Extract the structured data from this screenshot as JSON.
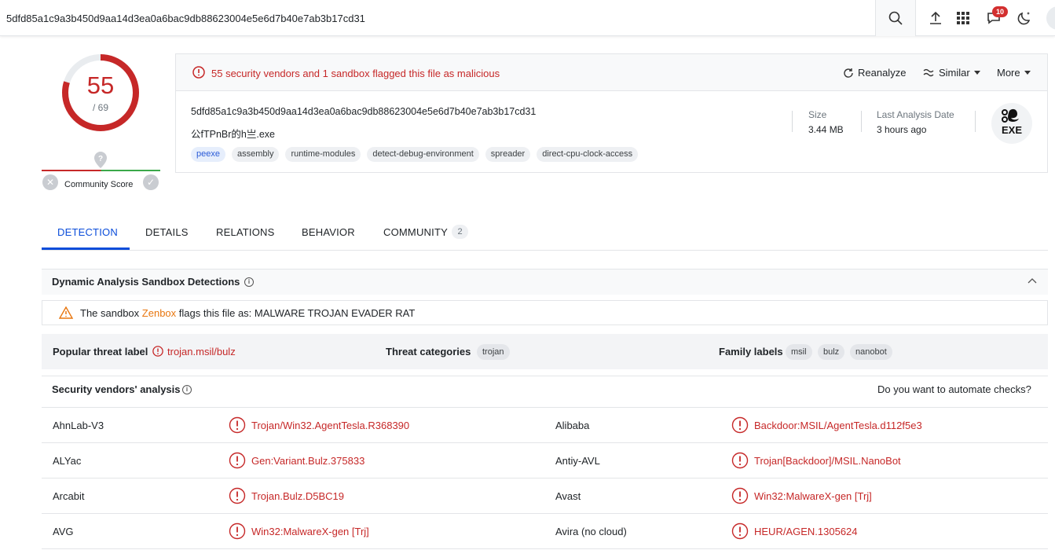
{
  "search": {
    "value": "5dfd85a1c9a3b450d9aa14d3ea0a6bac9db88623004e5e6d7b40e7ab3b17cd31"
  },
  "header": {
    "notifications_count": "10"
  },
  "score": {
    "detections": "55",
    "total": "/ 69",
    "fraction": 0.797
  },
  "community": {
    "label": "Community Score",
    "question": "?"
  },
  "summary": {
    "alert": "55 security vendors and 1 sandbox flagged this file as malicious",
    "actions": {
      "reanalyze": "Reanalyze",
      "similar": "Similar",
      "more": "More"
    },
    "hash": "5dfd85a1c9a3b450d9aa14d3ea0a6bac9db88623004e5e6d7b40e7ab3b17cd31",
    "filename": "公fTPnBr的h亗.exe",
    "tags": [
      "peexe",
      "assembly",
      "runtime-modules",
      "detect-debug-environment",
      "spreader",
      "direct-cpu-clock-access"
    ],
    "size_label": "Size",
    "size_value": "3.44 MB",
    "last_analysis_label": "Last Analysis Date",
    "last_analysis_value": "3 hours ago",
    "file_type": "EXE"
  },
  "tabs": [
    {
      "label": "DETECTION",
      "active": true
    },
    {
      "label": "DETAILS"
    },
    {
      "label": "RELATIONS"
    },
    {
      "label": "BEHAVIOR"
    },
    {
      "label": "COMMUNITY",
      "count": "2"
    }
  ],
  "sandbox": {
    "title": "Dynamic Analysis Sandbox Detections",
    "prefix": "The sandbox",
    "name": "Zenbox",
    "suffix": "flags this file as: MALWARE TROJAN EVADER RAT"
  },
  "threat": {
    "popular_label": "Popular threat label",
    "popular_value": "trojan.msil/bulz",
    "categories_label": "Threat categories",
    "categories": [
      "trojan"
    ],
    "family_label": "Family labels",
    "families": [
      "msil",
      "bulz",
      "nanobot"
    ]
  },
  "vendors": {
    "title": "Security vendors' analysis",
    "automate": "Do you want to automate checks?",
    "rows": [
      {
        "left": {
          "name": "AhnLab-V3",
          "result": "Trojan/Win32.AgentTesla.R368390"
        },
        "right": {
          "name": "Alibaba",
          "result": "Backdoor:MSIL/AgentTesla.d112f5e3"
        }
      },
      {
        "left": {
          "name": "ALYac",
          "result": "Gen:Variant.Bulz.375833"
        },
        "right": {
          "name": "Antiy-AVL",
          "result": "Trojan[Backdoor]/MSIL.NanoBot"
        }
      },
      {
        "left": {
          "name": "Arcabit",
          "result": "Trojan.Bulz.D5BC19"
        },
        "right": {
          "name": "Avast",
          "result": "Win32:MalwareX-gen [Trj]"
        }
      },
      {
        "left": {
          "name": "AVG",
          "result": "Win32:MalwareX-gen [Trj]"
        },
        "right": {
          "name": "Avira (no cloud)",
          "result": "HEUR/AGEN.1305624"
        }
      }
    ]
  },
  "colors": {
    "malicious": "#c62828",
    "accent": "#0b4dda",
    "sandbox_vendor": "#e8760f"
  }
}
